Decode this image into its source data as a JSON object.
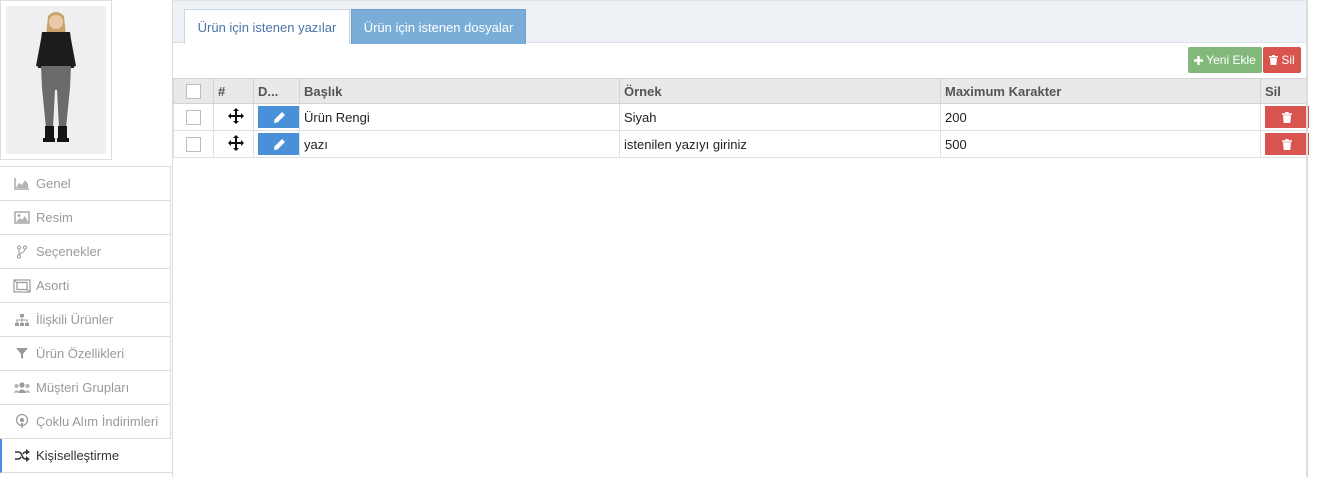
{
  "sidebar": {
    "product_image_alt": "product-photo",
    "items": [
      {
        "label": "Genel",
        "icon": "area-chart-icon",
        "active": false
      },
      {
        "label": "Resim",
        "icon": "image-icon",
        "active": false
      },
      {
        "label": "Seçenekler",
        "icon": "branch-icon",
        "active": false
      },
      {
        "label": "Asorti",
        "icon": "crop-icon",
        "active": false
      },
      {
        "label": "İlişkili Ürünler",
        "icon": "sitemap-icon",
        "active": false
      },
      {
        "label": "Ürün Özellikleri",
        "icon": "filter-icon",
        "active": false
      },
      {
        "label": "Müşteri Grupları",
        "icon": "users-icon",
        "active": false
      },
      {
        "label": "Çoklu Alım İndirimleri",
        "icon": "podcast-icon",
        "active": false
      },
      {
        "label": "Kişiselleştirme",
        "icon": "shuffle-icon",
        "active": true
      }
    ]
  },
  "tabs": [
    {
      "label": "Ürün için istenen yazılar",
      "active": true
    },
    {
      "label": "Ürün için istenen dosyalar",
      "active": false
    }
  ],
  "toolbar": {
    "add_label": "Yeni Ekle",
    "delete_label": "Sil"
  },
  "table": {
    "columns": [
      "",
      "#",
      "D...",
      "Başlık",
      "Örnek",
      "Maximum Karakter",
      "Sil"
    ],
    "rows": [
      {
        "title": "Ürün Rengi",
        "example": "Siyah",
        "max_chars": "200"
      },
      {
        "title": "yazı",
        "example": "istenilen yazıyı giriniz",
        "max_chars": "500"
      }
    ]
  },
  "colors": {
    "tab_inactive": "#7aaed9",
    "add_button": "#82b97a",
    "delete_button": "#d9534f",
    "edit_button": "#4a90d9",
    "active_menu_accent": "#4a90e2"
  }
}
